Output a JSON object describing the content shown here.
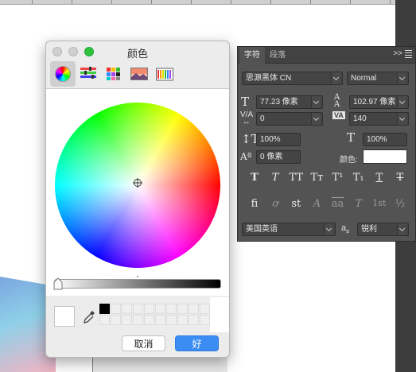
{
  "colorPicker": {
    "title": "颜色",
    "tabs": [
      {
        "name": "color-wheel"
      },
      {
        "name": "color-sliders"
      },
      {
        "name": "color-palettes"
      },
      {
        "name": "image-palettes"
      },
      {
        "name": "crayons"
      }
    ],
    "brightness": 1.0,
    "selectedColor": "#ffffff",
    "cancelLabel": "取消",
    "okLabel": "好",
    "accent": "#3b8cf3"
  },
  "characterPanel": {
    "tabs": {
      "character": "字符",
      "paragraph": "段落",
      "more": ">>"
    },
    "fontFamily": "思源黑体 CN",
    "fontStyle": "Normal",
    "fontSize": "77.23 像素",
    "leading": "102.97 像素",
    "kerning": "0",
    "tracking": "140",
    "verticalScale": "100%",
    "horizontalScale": "100%",
    "baselineShift": "0 像素",
    "colorLabel": "颜色:",
    "textColor": "#ffffff",
    "language": "美国英语",
    "antiAlias": "锐利",
    "aaIcon": "a",
    "styleButtons": [
      "T",
      "T",
      "TT",
      "Tт",
      "T¹",
      "T₁",
      "T",
      "T"
    ],
    "openTypeButtons": [
      "fi",
      "ơ",
      "st",
      "A",
      "aa",
      "T",
      "1st",
      "½"
    ]
  }
}
